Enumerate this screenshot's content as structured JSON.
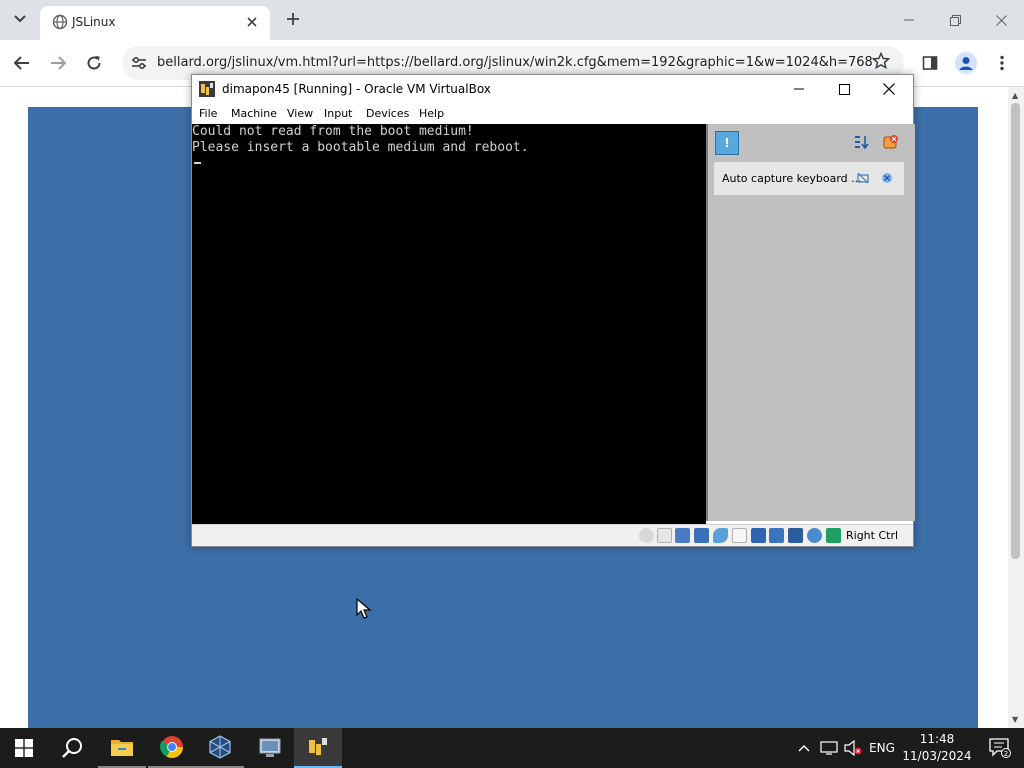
{
  "browser": {
    "tab_title": "JSLinux",
    "url": "bellard.org/jslinux/vm.html?url=https://bellard.org/jslinux/win2k.cfg&mem=192&graphic=1&w=1024&h=768",
    "icons": [
      "tab-search-icon",
      "close-icon",
      "plus-icon",
      "minimize-icon",
      "restore-icon",
      "back-icon",
      "forward-icon",
      "reload-icon",
      "site-info-icon",
      "star-icon",
      "side-panel-icon",
      "profile-icon",
      "kebab-menu-icon"
    ]
  },
  "vbox": {
    "title": "dimapon45 [Running] - Oracle VM VirtualBox",
    "menu": [
      "File",
      "Machine",
      "View",
      "Input",
      "Devices",
      "Help"
    ],
    "console_lines": [
      "Could not read from the boot medium!",
      "Please insert a bootable medium and reboot."
    ],
    "notification": "Auto capture keyboard ...",
    "host_key": "Right Ctrl"
  },
  "taskbar": {
    "apps": [
      "start-icon",
      "search-icon",
      "file-explorer-icon",
      "chrome-icon",
      "virtualbox-icon",
      "network-app-icon",
      "vm-window-icon"
    ],
    "language": "ENG",
    "time": "11:48",
    "date": "11/03/2024",
    "notification_count": "2"
  },
  "colors": {
    "desktop_blue": "#3c6ea8",
    "tabstrip": "#dee1e6",
    "taskbar": "#1c1c1c"
  }
}
